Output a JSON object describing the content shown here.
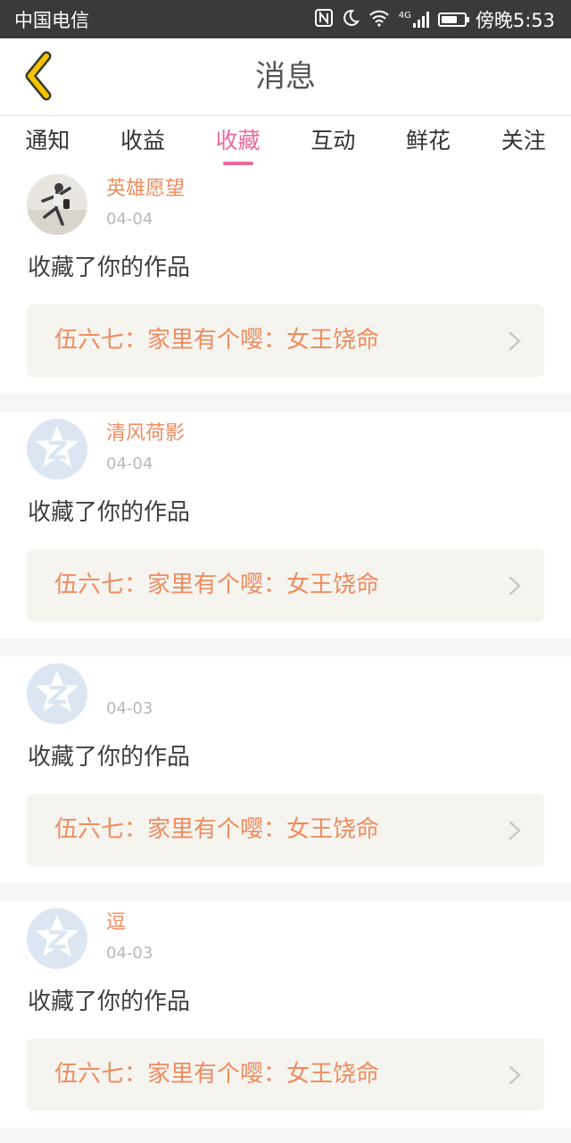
{
  "status_bar": {
    "carrier": "中国电信",
    "network_type": "4G",
    "time": "傍晚5:53",
    "battery_level_percent": 70,
    "icons": [
      "nfc-icon",
      "moon-icon",
      "wifi-icon",
      "signal-icon",
      "battery-icon"
    ]
  },
  "header": {
    "title": "消息",
    "back_icon": "back-chevron-icon",
    "accent_color": "#f5c400"
  },
  "tabs": [
    {
      "label": "通知",
      "active": false
    },
    {
      "label": "收益",
      "active": false
    },
    {
      "label": "收藏",
      "active": true
    },
    {
      "label": "互动",
      "active": false
    },
    {
      "label": "鲜花",
      "active": false
    },
    {
      "label": "关注",
      "active": false
    }
  ],
  "colors": {
    "active_tab": "#e86aa0",
    "name_and_link": "#ef8c5f",
    "date": "#b8b8b8",
    "link_background": "#f5f4ef"
  },
  "messages": [
    {
      "user_name": "英雄愿望",
      "avatar": "photo-avatar",
      "date": "04-04",
      "action": "收藏了你的作品",
      "work_title": "伍六七：家里有个嘤：女王饶命"
    },
    {
      "user_name": "清风荷影",
      "avatar": "default-avatar",
      "date": "04-04",
      "action": "收藏了你的作品",
      "work_title": "伍六七：家里有个嘤：女王饶命"
    },
    {
      "user_name": "",
      "avatar": "default-avatar",
      "date": "04-03",
      "action": "收藏了你的作品",
      "work_title": "伍六七：家里有个嘤：女王饶命"
    },
    {
      "user_name": "逗",
      "avatar": "default-avatar",
      "date": "04-03",
      "action": "收藏了你的作品",
      "work_title": "伍六七：家里有个嘤：女王饶命"
    }
  ]
}
